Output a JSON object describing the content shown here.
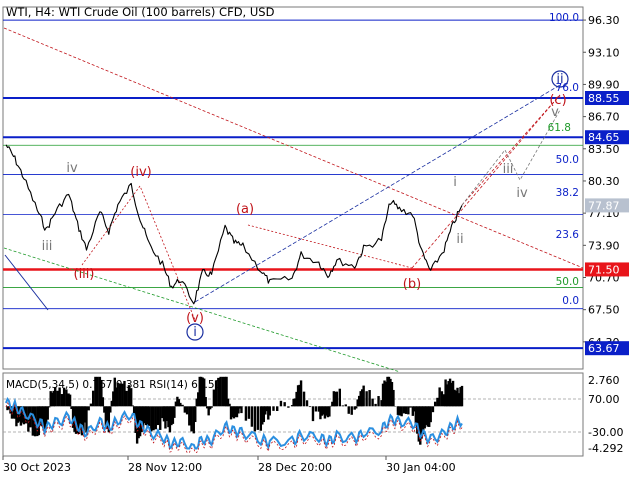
{
  "header": {
    "title": "WTI, H4:  WTI Crude Oil (100 barrels) CFD, USD"
  },
  "indicator_header": {
    "text": "MACD(5,34,5) 0.767 0.381 RSI(14) 61.51"
  },
  "colors": {
    "price_line": "#000000",
    "axis_blue": "#1a2fbf",
    "level_blue": "#0a1fc8",
    "level_red": "#e8141a",
    "fib_green": "#1f9a2a",
    "wave_red": "#c0141a",
    "wave_gray": "#777777",
    "wave_blue": "#1a2fa0",
    "rsi_blue": "#2b8fe0",
    "current_price_bg": "#b8c1cf"
  },
  "chart_data": [
    {
      "type": "line",
      "title": "WTI, H4:  WTI Crude Oil (100 barrels) CFD, USD",
      "x_tick_labels": [
        "30 Oct 2023",
        "28 Nov 12:00",
        "28 Dec 20:00",
        "30 Jan 04:00"
      ],
      "price_axis_labels": [
        "96.30",
        "93.10",
        "89.90",
        "86.70",
        "83.50",
        "80.30",
        "77.10",
        "73.90",
        "70.70",
        "67.50",
        "64.30"
      ],
      "ylim": [
        61.6,
        97.6
      ],
      "current_price": "77.87",
      "grid": false,
      "series": [
        {
          "x": [
            "2023-10-30",
            "2023-11-01",
            "2023-11-03",
            "2023-11-06",
            "2023-11-08",
            "2023-11-10",
            "2023-11-13",
            "2023-11-15",
            "2023-11-17",
            "2023-11-20",
            "2023-11-22",
            "2023-11-24",
            "2023-11-27",
            "2023-11-29",
            "2023-12-01",
            "2023-12-04",
            "2023-12-06",
            "2023-12-08",
            "2023-12-11",
            "2023-12-13",
            "2023-12-15",
            "2023-12-18",
            "2023-12-20",
            "2023-12-22",
            "2023-12-26",
            "2023-12-28",
            "2024-01-02",
            "2024-01-04",
            "2024-01-08",
            "2024-01-10",
            "2024-01-12",
            "2024-01-16",
            "2024-01-18",
            "2024-01-22",
            "2024-01-24",
            "2024-01-26",
            "2024-01-29",
            "2024-01-31",
            "2024-02-02",
            "2024-02-05",
            "2024-02-07",
            "2024-02-09"
          ],
          "values": [
            83.9,
            82.5,
            80.6,
            77.4,
            75.4,
            77.2,
            79.0,
            76.0,
            73.5,
            77.2,
            75.3,
            77.9,
            79.9,
            76.5,
            74.0,
            72.0,
            69.8,
            70.5,
            68.2,
            71.2,
            71.0,
            75.7,
            74.2,
            73.8,
            71.4,
            70.2,
            70.6,
            73.0,
            72.2,
            70.9,
            72.4,
            71.8,
            73.6,
            74.5,
            78.3,
            77.5,
            77.0,
            73.2,
            71.3,
            73.5,
            76.0,
            77.87
          ]
        }
      ],
      "horizontal_levels": [
        {
          "label": "96.30",
          "value": 96.3,
          "kind": "blue-thin"
        },
        {
          "label": "88.55",
          "value": 88.55,
          "kind": "blue-thick"
        },
        {
          "label": "84.65",
          "value": 84.65,
          "kind": "blue-thick"
        },
        {
          "label": "71.50",
          "value": 71.5,
          "kind": "red-thick"
        },
        {
          "label": "63.67",
          "value": 63.67,
          "kind": "blue-thick"
        }
      ],
      "fibonacci_levels": [
        "100.0",
        "76.0",
        "61.8",
        "50.0",
        "38.2",
        "23.6",
        "50.0",
        "0.0"
      ],
      "wave_labels": [
        "iv",
        "iii",
        "(iv)",
        "(iii)",
        "(v)",
        "i",
        "(a)",
        "(b)",
        "(c)",
        "i",
        "ii",
        "ii",
        "iii",
        "iv",
        "v"
      ]
    },
    {
      "type": "bar",
      "title": "MACD(5,34,5) 0.767 0.381 RSI(14) 61.51",
      "axis_labels": [
        "2.760",
        "70.00",
        "-30.00",
        "-4.292"
      ],
      "ylim": [
        -4.292,
        2.76
      ]
    }
  ]
}
